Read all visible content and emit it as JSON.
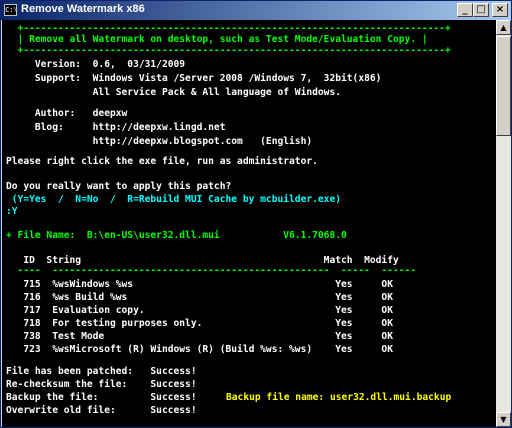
{
  "window": {
    "icon": "C:\\",
    "title": "Remove Watermark x86",
    "minimize_glyph": "_",
    "maximize_glyph": "□",
    "close_glyph": "×"
  },
  "console": {
    "banner_top": "  +-------------------------------------------------------------------------+",
    "banner_text": "  | Remove all Watermark on desktop, such as Test Mode/Evaluation Copy. |",
    "banner_bottom": "  +-------------------------------------------------------------------------+",
    "version": "     Version:  0.6,  03/31/2009",
    "support": "     Support:  Windows Vista /Server 2008 /Windows 7,  32bit(x86)",
    "support2": "               All Service Pack & All language of Windows.",
    "author": "     Author:   deepxw",
    "blog": "     Blog:     http://deepxw.lingd.net",
    "blog2": "               http://deepxw.blogspot.com   (English)",
    "admin_note": "Please right click the exe file, run as administrator.",
    "confirm_question": "Do you really want to apply this patch?",
    "options": " (Y=Yes  /  N=No  /  R=Rebuild MUI Cache by mcbuilder.exe)",
    "prompt_input": ":Y",
    "file_name_line": "+ File Name:  B:\\en-US\\user32.dll.mui           V6.1.7068.0",
    "table_header": "   ID  String                                          Match  Modify",
    "table_rule": "  ----  ------------------------------------------------  -----  ------",
    "rows": [
      "   715  %wsWindows %ws                                   Yes     OK",
      "   716  %ws Build %ws                                    Yes     OK",
      "   717  Evaluation copy.                                 Yes     OK",
      "   718  For testing purposes only.                       Yes     OK",
      "   738  Test Mode                                        Yes     OK",
      "   723  %wsMicrosoft (R) Windows (R) (Build %ws: %ws)    Yes     OK"
    ],
    "status1": "File has been patched:   Success!",
    "status2": "Re-checksum the file:    Success!",
    "status3_label": "Backup the file:         Success!",
    "backup_note": "Backup file name: user32.dll.mui.backup",
    "status4": "Overwrite old file:      Success!"
  },
  "scrollbar": {
    "up_glyph": "▲",
    "down_glyph": "▼"
  }
}
